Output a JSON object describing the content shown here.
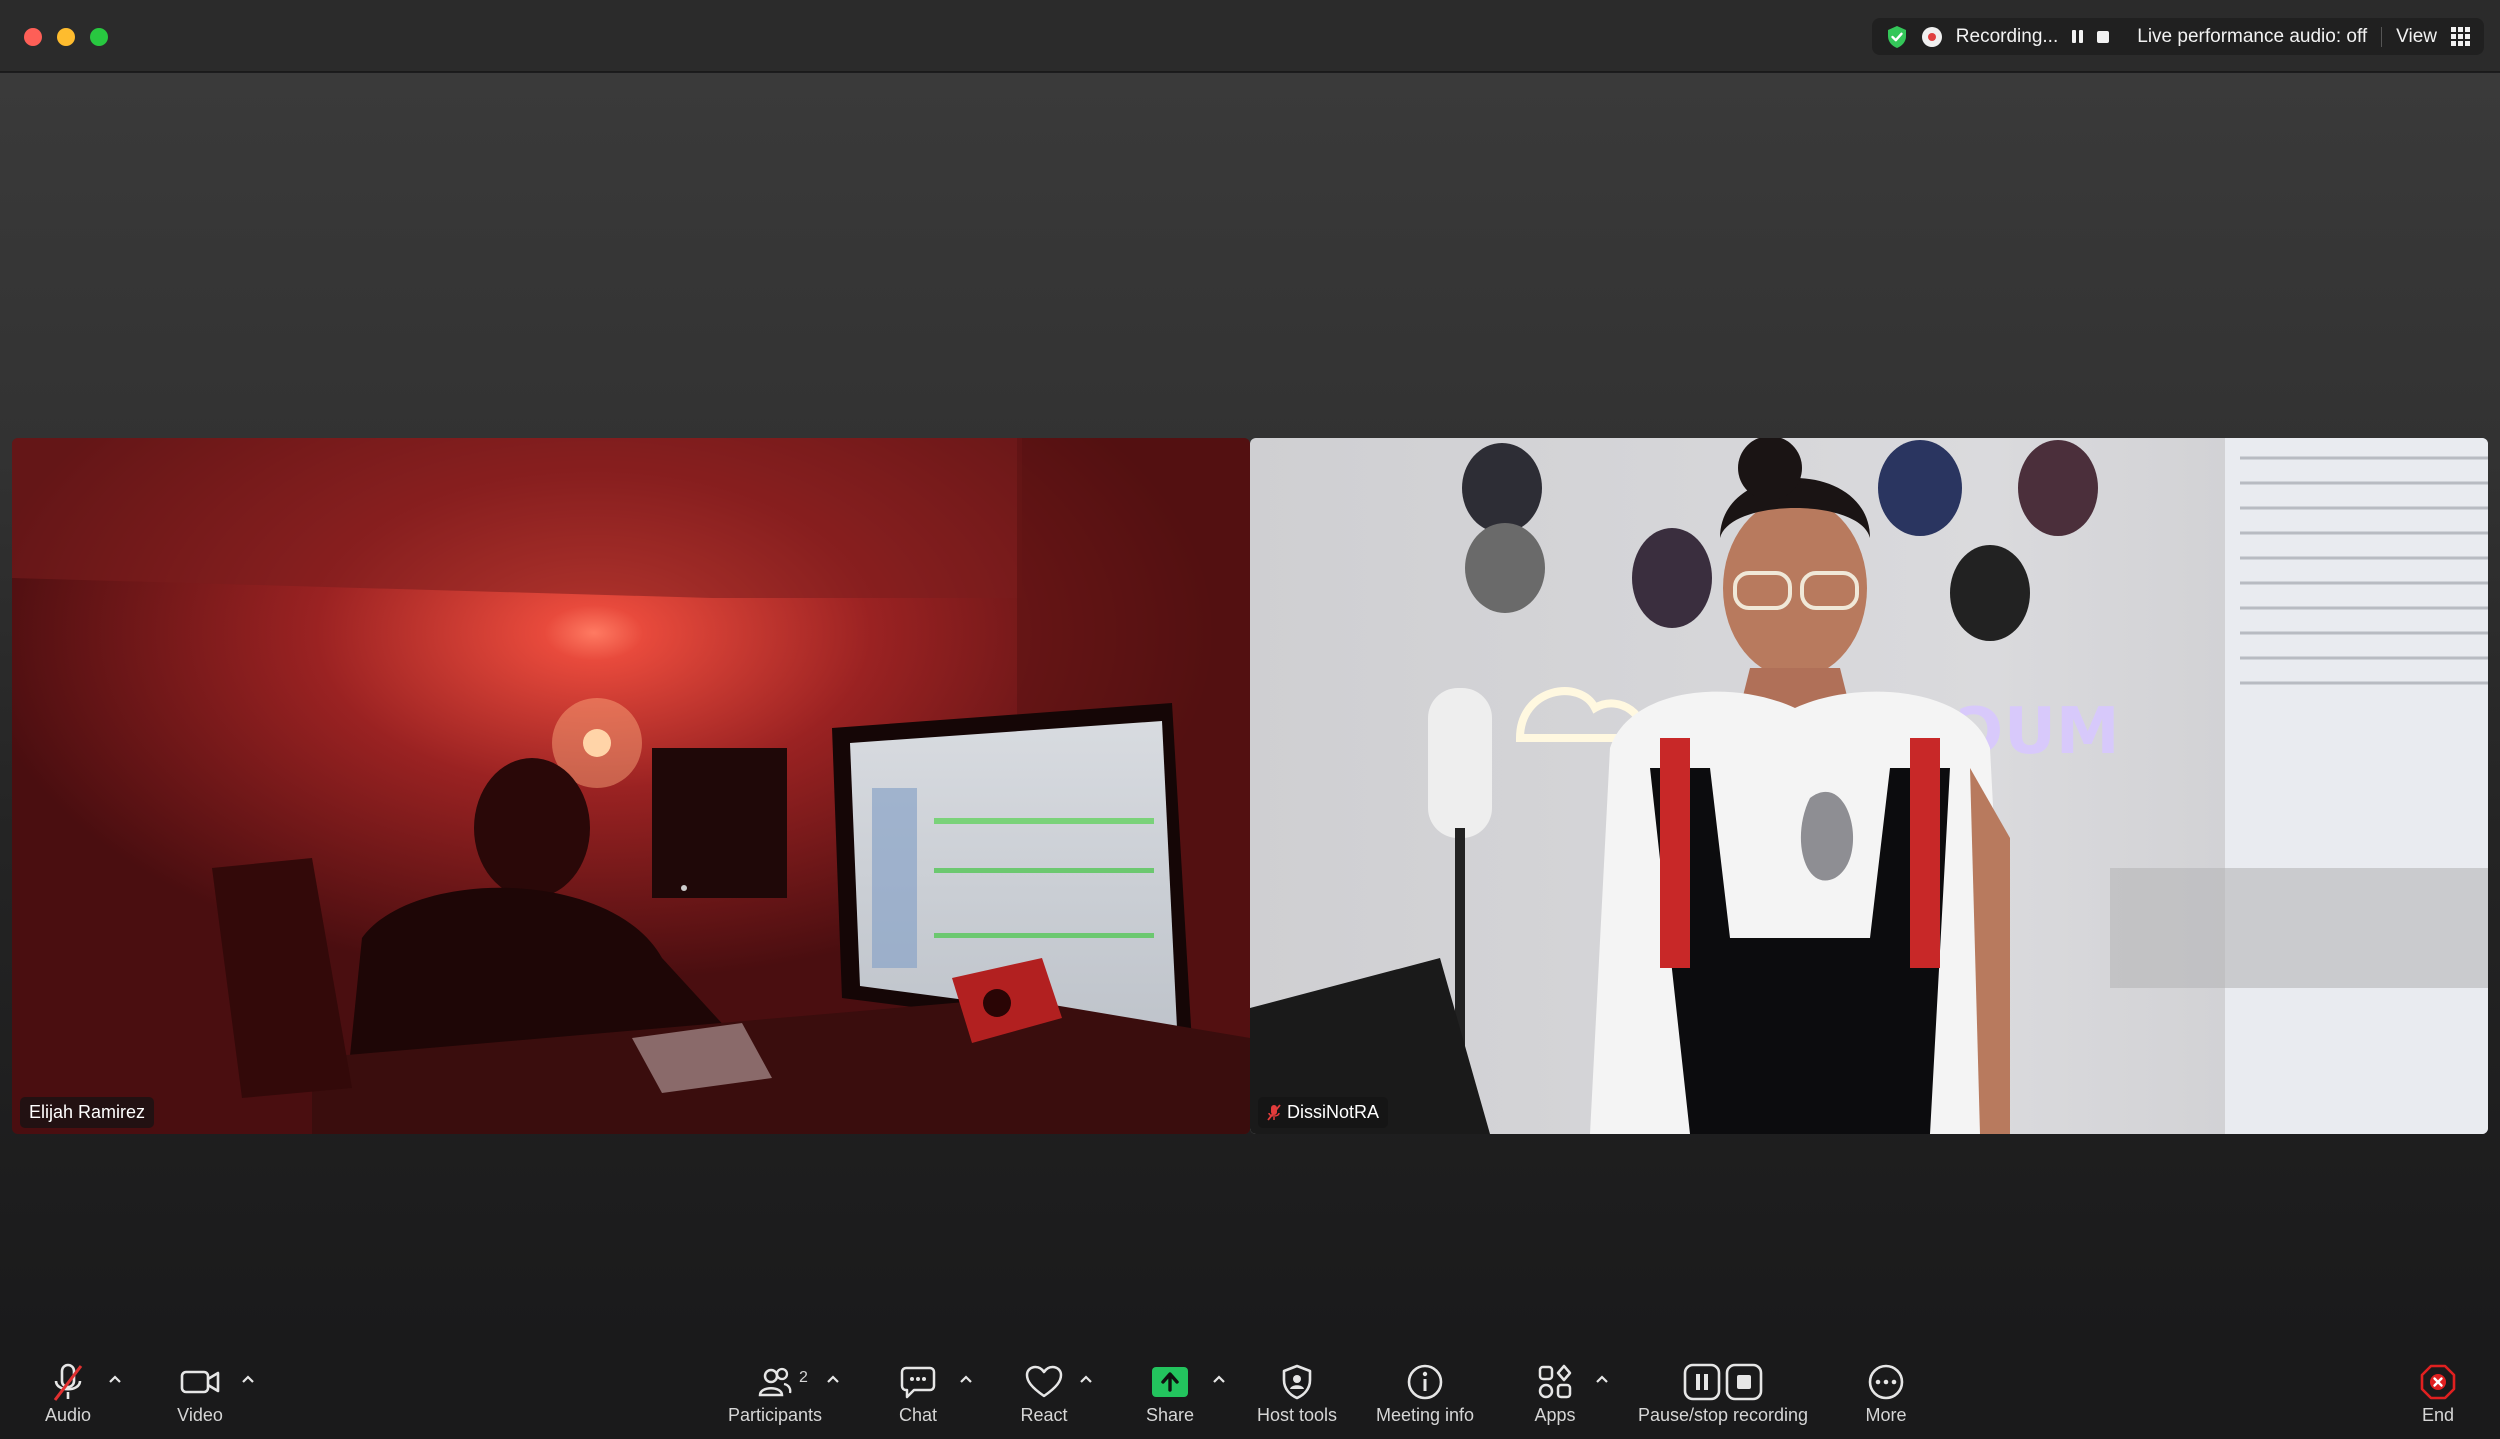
{
  "titlebar": {
    "recording_label": "Recording...",
    "performance_audio": "Live performance audio: off",
    "view_label": "View",
    "shield_icon": "shield-check-icon",
    "accent_green": "#34c759",
    "record_red": "#e04040"
  },
  "participants": [
    {
      "name": "Elijah Ramirez",
      "muted": false
    },
    {
      "name": "DissiNotRA",
      "muted": true
    }
  ],
  "toolbar": {
    "audio": "Audio",
    "video": "Video",
    "participants": "Participants",
    "participants_count": "2",
    "chat": "Chat",
    "react": "React",
    "share": "Share",
    "host_tools": "Host tools",
    "meeting_info": "Meeting info",
    "apps": "Apps",
    "recording": "Pause/stop recording",
    "more": "More",
    "end": "End",
    "end_color": "#e02020",
    "share_color": "#23c45e"
  }
}
